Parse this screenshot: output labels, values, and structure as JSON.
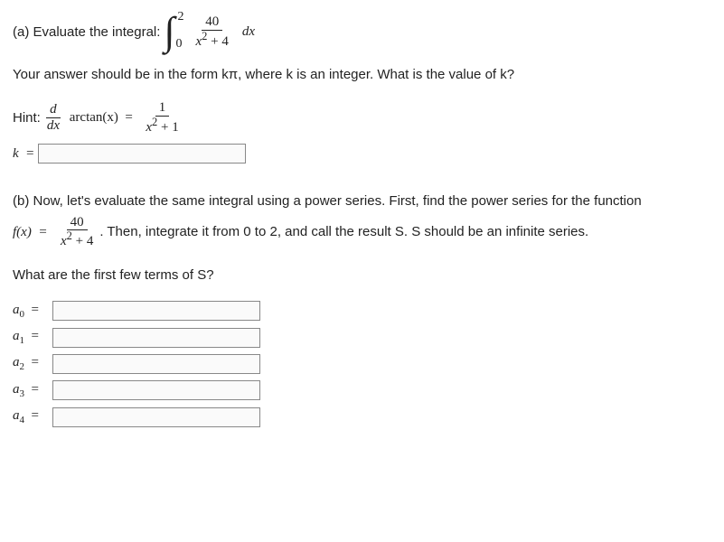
{
  "partA": {
    "prompt_prefix": "(a) Evaluate the integral:",
    "int_lower": "0",
    "int_upper": "2",
    "frac_num": "40",
    "frac_den_left": "x",
    "frac_den_sup": "2",
    "frac_den_right": " + 4",
    "dx": "dx",
    "answer_line": "Your answer should be in the form kπ, where k is an integer. What is the value of k?",
    "hint_label": "Hint: ",
    "hint_frac_num": "d",
    "hint_frac_den": "dx",
    "hint_fn": " arctan(x)  =  ",
    "hint_r_num": "1",
    "hint_r_den_left": "x",
    "hint_r_den_sup": "2",
    "hint_r_den_right": " + 1",
    "k_label": "k  = "
  },
  "partB": {
    "text1": "(b) Now, let's evaluate the same integral using a power series. First, find the power series for the function ",
    "fx": "f(x)  =  ",
    "frac_num": "40",
    "frac_den_left": "x",
    "frac_den_sup": "2",
    "frac_den_right": " + 4",
    "text2": ". Then, integrate it from 0 to 2, and call the result S. S should be an infinite series.",
    "question": "What are the first few terms of S?",
    "terms": [
      {
        "sym": "a",
        "sub": "0",
        "eq": "  = "
      },
      {
        "sym": "a",
        "sub": "1",
        "eq": "  = "
      },
      {
        "sym": "a",
        "sub": "2",
        "eq": "  = "
      },
      {
        "sym": "a",
        "sub": "3",
        "eq": "  = "
      },
      {
        "sym": "a",
        "sub": "4",
        "eq": "  = "
      }
    ]
  }
}
